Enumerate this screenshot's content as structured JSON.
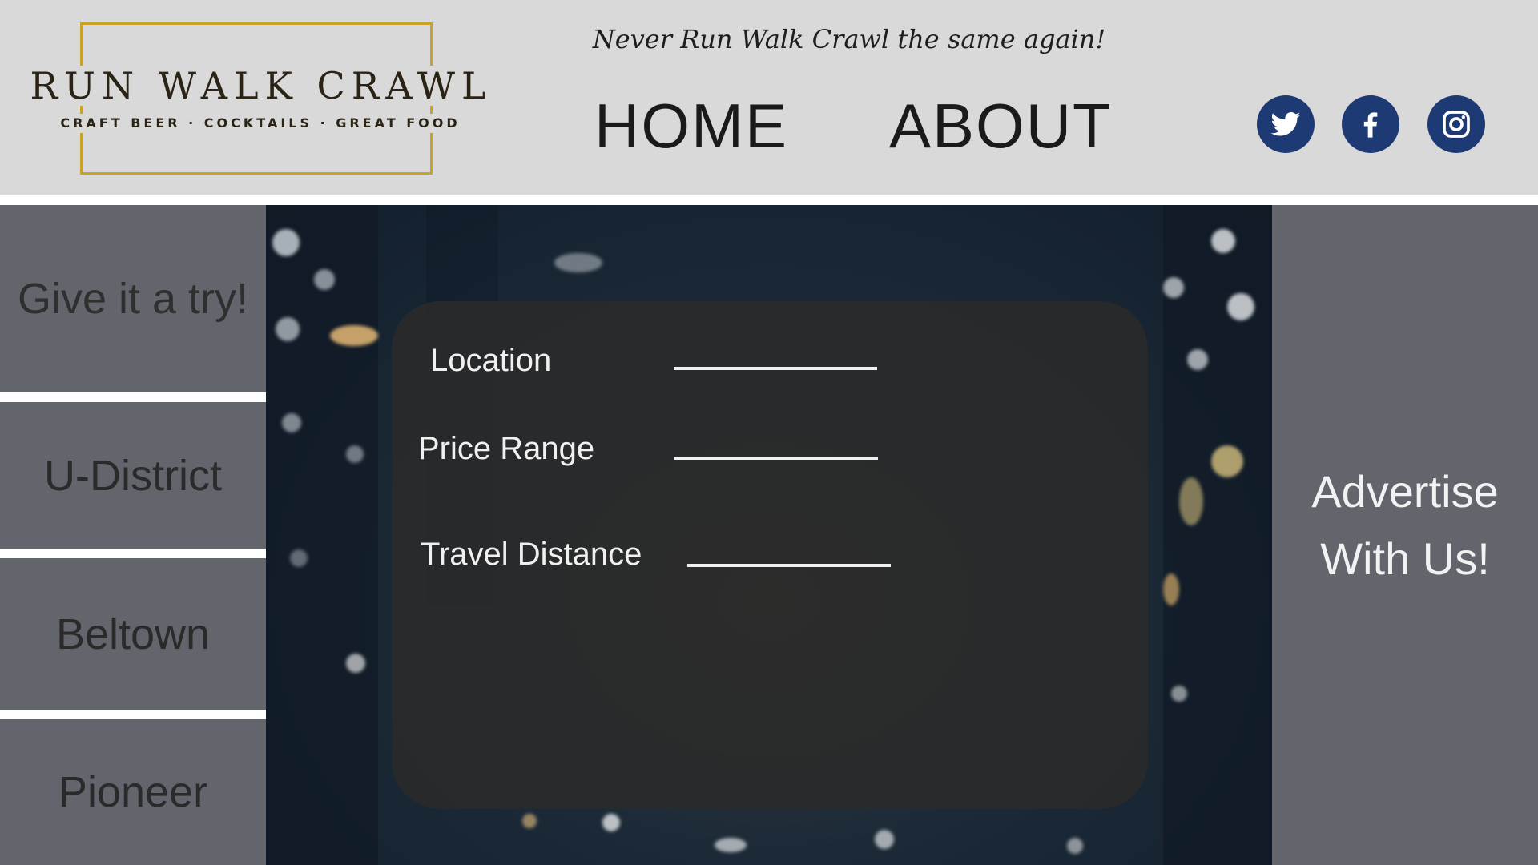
{
  "header": {
    "logo_title": "RUN WALK CRAWL",
    "logo_subtitle": "CRAFT BEER · COCKTAILS · GREAT FOOD",
    "tagline": "Never Run Walk Crawl the same again!",
    "nav": [
      {
        "label": "HOME"
      },
      {
        "label": "ABOUT"
      }
    ],
    "social": [
      {
        "icon": "twitter-icon"
      },
      {
        "icon": "facebook-icon"
      },
      {
        "icon": "instagram-icon"
      }
    ],
    "accent_color": "#c9a227",
    "social_color": "#1d3a74"
  },
  "left_sidebar": {
    "items": [
      {
        "label": "Give it a try!"
      },
      {
        "label": "U-District"
      },
      {
        "label": "Beltown"
      },
      {
        "label": "Pioneer"
      }
    ]
  },
  "right_sidebar": {
    "line1": "Advertise",
    "line2": "With Us!"
  },
  "search_form": {
    "fields": [
      {
        "label": "Location",
        "value": ""
      },
      {
        "label": "Price Range",
        "value": ""
      },
      {
        "label": "Travel Distance",
        "value": ""
      }
    ]
  }
}
